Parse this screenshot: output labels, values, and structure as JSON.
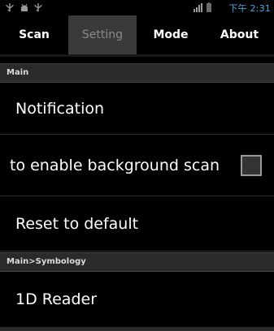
{
  "status_bar": {
    "time": "下午 2:31",
    "icons": [
      "usb-icon",
      "android-debug-icon",
      "usb-icon",
      "signal-icon",
      "battery-icon"
    ]
  },
  "tabs": [
    {
      "label": "Scan",
      "selected": false
    },
    {
      "label": "Setting",
      "selected": true
    },
    {
      "label": "Mode",
      "selected": false
    },
    {
      "label": "About",
      "selected": false
    }
  ],
  "sections": [
    {
      "title": "Main"
    },
    {
      "title": "Main>Symbology"
    }
  ],
  "items": [
    {
      "label": "Notification"
    },
    {
      "label": "to enable background scan",
      "checked": false
    },
    {
      "label": "Reset to default"
    },
    {
      "label": "1D Reader"
    }
  ],
  "colors": {
    "accent": "#4aa9e0",
    "background": "#000000",
    "section": "#2a2a2a"
  }
}
